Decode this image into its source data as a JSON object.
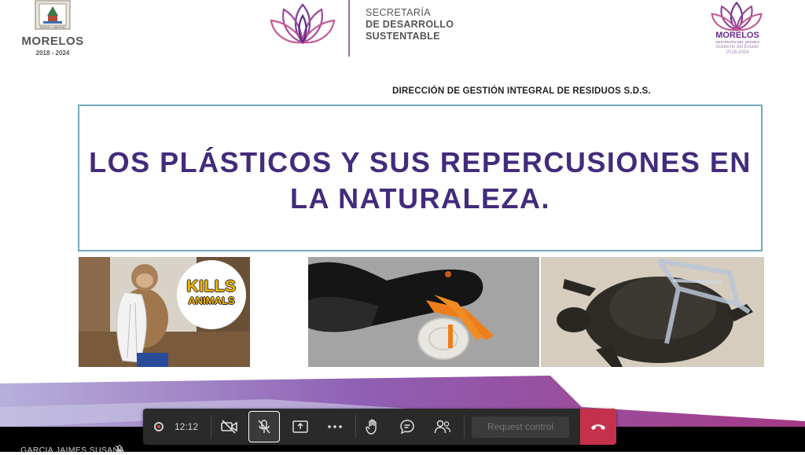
{
  "header": {
    "left_logo": {
      "name": "MORELOS",
      "years": "2018 - 2024",
      "icon": "coat-of-arms"
    },
    "center": {
      "line1": "SECRETARÍA",
      "line2": "DE DESARROLLO",
      "line3": "SUSTENTABLE",
      "icon": "lotus-logo"
    },
    "right_logo": {
      "name": "MORELOS",
      "tagline": "ANFITRIÓN DEL MUNDO",
      "gov": "Gobierno del Estado",
      "years": "2018-2024",
      "icon": "lotus-logo"
    }
  },
  "slide": {
    "direccion": "DIRECCIÓN DE GESTIÓN INTEGRAL DE RESIDUOS S.D.S.",
    "title": "LOS PLÁSTICOS Y SUS REPERCUSIONES EN LA NATURALEZA.",
    "title_color": "#432b7c",
    "photos": [
      {
        "subject": "monkey-with-plastic-bag",
        "badge_line1": "KILLS",
        "badge_line2": "ANIMALS"
      },
      {
        "subject": "bird-with-plastic-ring"
      },
      {
        "subject": "turtle-with-plastic-strap"
      }
    ]
  },
  "toolbar": {
    "timer": "12:12",
    "request_control": "Request control",
    "icons": [
      "record-icon",
      "camera-off-icon",
      "mic-off-icon",
      "share-screen-icon",
      "more-icon",
      "raise-hand-icon",
      "chat-icon",
      "participants-icon",
      "hang-up-icon"
    ],
    "hangup_color": "#c4314b"
  },
  "participant": {
    "name": "GARCIA JAIMES SUSANA"
  }
}
